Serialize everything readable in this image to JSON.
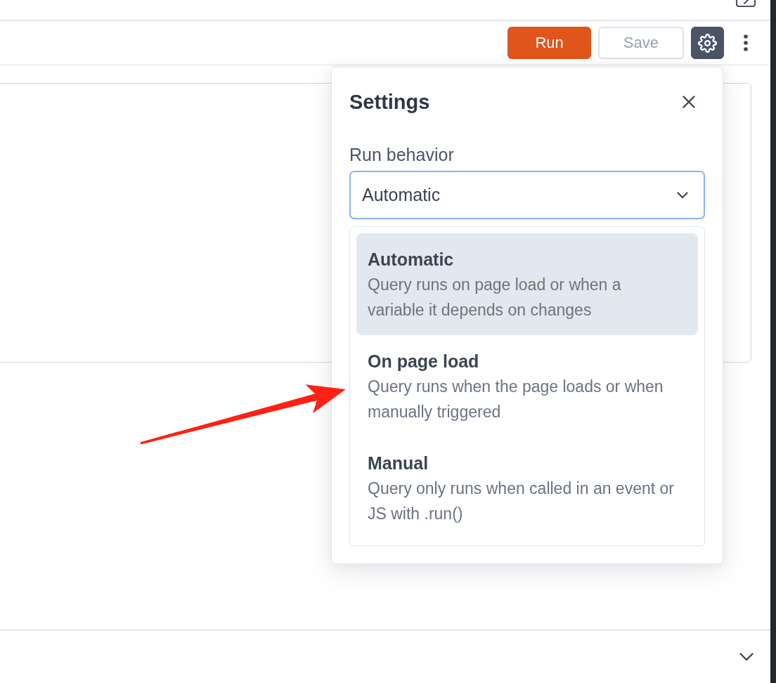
{
  "toolbar": {
    "buttons": [
      {
        "kind": "primary",
        "label": "Run",
        "disabled": false
      },
      {
        "kind": "secondary",
        "label": "Save",
        "disabled": true
      }
    ],
    "settings_button": {
      "pressed": true
    }
  },
  "settings": {
    "title": "Settings",
    "field": {
      "label": "Run behavior",
      "value": "Automatic",
      "focused": true
    },
    "options": [
      {
        "title": "Automatic",
        "description_lines": [
          "Query runs on page load or when a",
          "variable it depends on changes"
        ],
        "selected": true,
        "arrow": false
      },
      {
        "title": "On page load",
        "description_lines": [
          "Query runs when the page loads or when",
          "manually triggered"
        ],
        "selected": false,
        "arrow": true
      },
      {
        "title": "Manual",
        "description_lines": [
          "Query only runs when called in an event or",
          "JS with .run()"
        ],
        "selected": false,
        "arrow": false
      }
    ]
  }
}
